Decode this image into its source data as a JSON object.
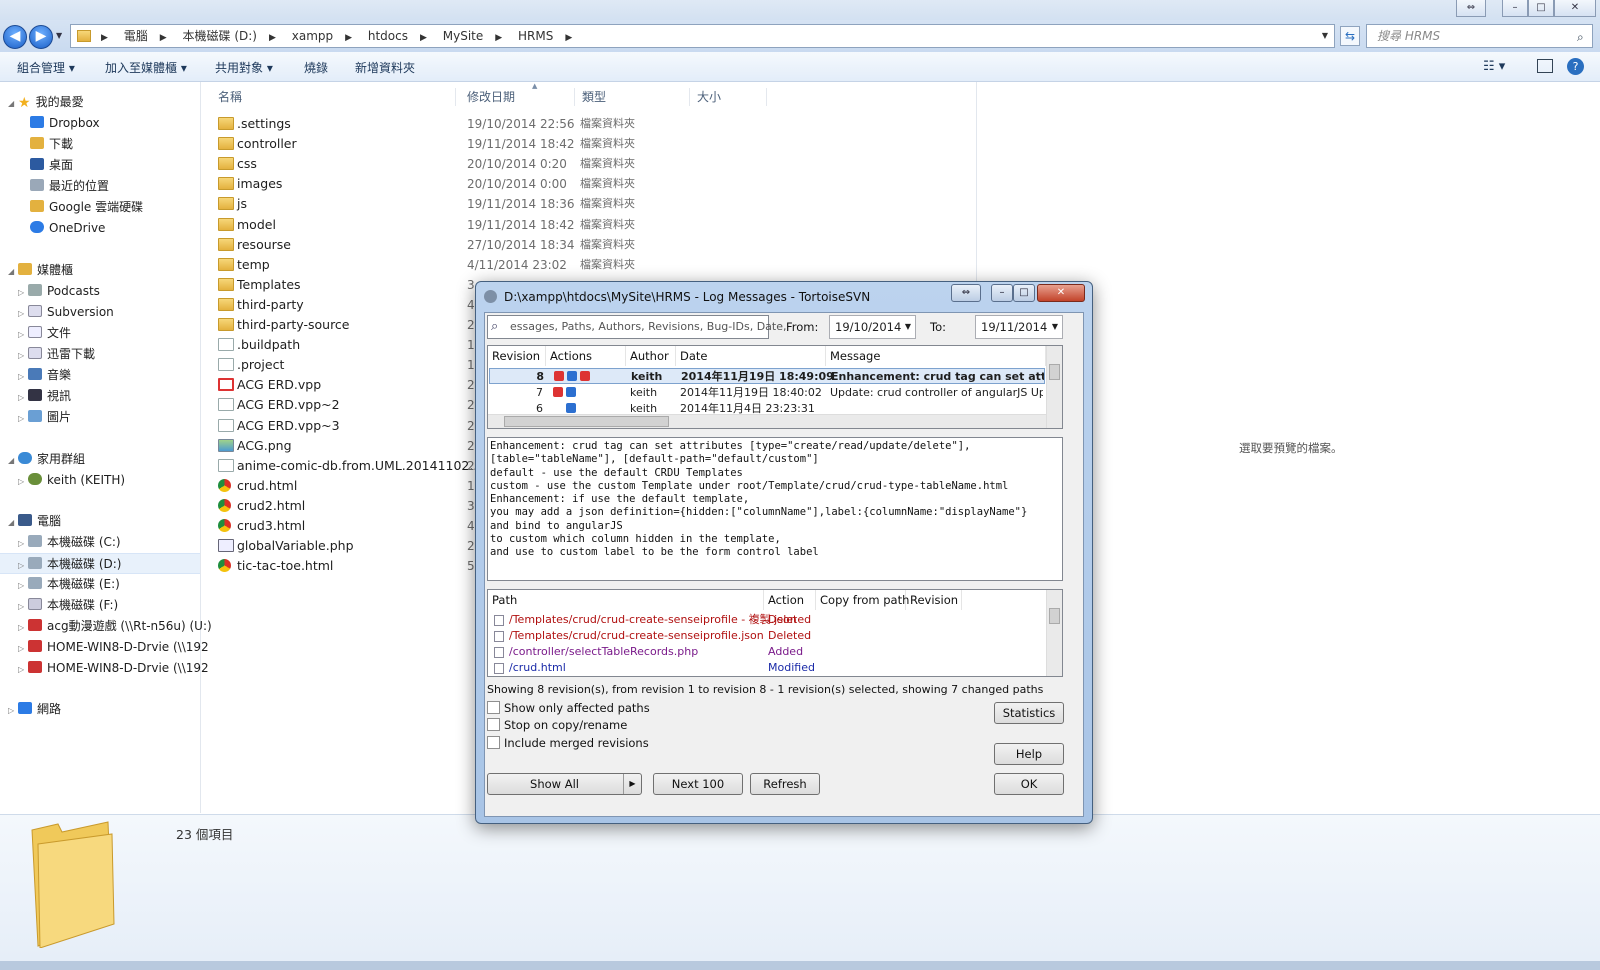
{
  "window": {
    "caption_buttons": [
      "⇔",
      "–",
      "□",
      "✕"
    ]
  },
  "address": {
    "crumbs": [
      "電腦",
      "本機磁碟 (D:)",
      "xampp",
      "htdocs",
      "MySite",
      "HRMS"
    ],
    "search_placeholder": "搜尋 HRMS"
  },
  "toolbar": {
    "organize": "組合管理 ▾",
    "add_library": "加入至媒體櫃 ▾",
    "share": "共用對象 ▾",
    "burn": "燒錄",
    "new_folder": "新增資料夾"
  },
  "sidebar": {
    "favorites": "我的最愛",
    "fav_items": [
      "Dropbox",
      "下載",
      "桌面",
      "最近的位置",
      "Google 雲端硬碟",
      "OneDrive"
    ],
    "libraries": "媒體櫃",
    "lib_items": [
      "Podcasts",
      "Subversion",
      "文件",
      "迅雷下載",
      "音樂",
      "視訊",
      "圖片"
    ],
    "homegroup": "家用群組",
    "home_items": [
      "keith (KEITH)"
    ],
    "computer": "電腦",
    "comp_items": [
      "本機磁碟 (C:)",
      "本機磁碟 (D:)",
      "本機磁碟 (E:)",
      "本機磁碟 (F:)",
      "acg動漫遊戲 (\\\\Rt-n56u) (U:)",
      "HOME-WIN8-D-Drvie (\\\\192",
      "HOME-WIN8-D-Drvie (\\\\192"
    ],
    "network": "網路"
  },
  "filelist": {
    "headers": {
      "name": "名稱",
      "modified": "修改日期",
      "type": "類型",
      "size": "大小"
    },
    "rows": [
      {
        "name": ".settings",
        "date": "19/10/2014 22:56",
        "type": "檔案資料夾",
        "kind": "folder"
      },
      {
        "name": "controller",
        "date": "19/11/2014 18:42",
        "type": "檔案資料夾",
        "kind": "folder"
      },
      {
        "name": "css",
        "date": "20/10/2014 0:20",
        "type": "檔案資料夾",
        "kind": "folder"
      },
      {
        "name": "images",
        "date": "20/10/2014 0:00",
        "type": "檔案資料夾",
        "kind": "folder"
      },
      {
        "name": "js",
        "date": "19/11/2014 18:36",
        "type": "檔案資料夾",
        "kind": "folder"
      },
      {
        "name": "model",
        "date": "19/11/2014 18:42",
        "type": "檔案資料夾",
        "kind": "folder"
      },
      {
        "name": "resourse",
        "date": "27/10/2014 18:34",
        "type": "檔案資料夾",
        "kind": "folder"
      },
      {
        "name": "temp",
        "date": "4/11/2014 23:02",
        "type": "檔案資料夾",
        "kind": "folder"
      },
      {
        "name": "Templates",
        "date": "3",
        "type": "",
        "kind": "folder"
      },
      {
        "name": "third-party",
        "date": "4",
        "type": "",
        "kind": "folder"
      },
      {
        "name": "third-party-source",
        "date": "2",
        "type": "",
        "kind": "folder"
      },
      {
        "name": ".buildpath",
        "date": "1",
        "type": "",
        "kind": "doc"
      },
      {
        "name": ".project",
        "date": "1",
        "type": "",
        "kind": "doc"
      },
      {
        "name": "ACG ERD.vpp",
        "date": "2",
        "type": "",
        "kind": "vpp"
      },
      {
        "name": "ACG ERD.vpp~2",
        "date": "2",
        "type": "",
        "kind": "doc"
      },
      {
        "name": "ACG ERD.vpp~3",
        "date": "2",
        "type": "",
        "kind": "doc"
      },
      {
        "name": "ACG.png",
        "date": "2",
        "type": "",
        "kind": "png"
      },
      {
        "name": "anime-comic-db.from.UML.20141102....",
        "date": "2",
        "type": "",
        "kind": "doc"
      },
      {
        "name": "crud.html",
        "date": "1",
        "type": "",
        "kind": "chr"
      },
      {
        "name": "crud2.html",
        "date": "3",
        "type": "",
        "kind": "chr"
      },
      {
        "name": "crud3.html",
        "date": "4",
        "type": "",
        "kind": "chr"
      },
      {
        "name": "globalVariable.php",
        "date": "2",
        "type": "",
        "kind": "php"
      },
      {
        "name": "tic-tac-toe.html",
        "date": "5",
        "type": "",
        "kind": "chr"
      }
    ]
  },
  "preview_text": "選取要預覽的檔案。",
  "status_count": "23 個項目",
  "dialog": {
    "title": "D:\\xampp\\htdocs\\MySite\\HRMS - Log Messages - TortoiseSVN",
    "filter_placeholder": "essages, Paths, Authors, Revisions, Bug-IDs, Date,",
    "from_label": "From:",
    "from_value": "19/10/2014",
    "to_label": "To:",
    "to_value": "19/11/2014",
    "log_headers": {
      "revision": "Revision",
      "actions": "Actions",
      "author": "Author",
      "date": "Date",
      "message": "Message"
    },
    "log_rows": [
      {
        "rev": "8",
        "author": "keith",
        "date": "2014年11月19日 18:49:09",
        "msg": "Enhancement: crud tag can set attribute"
      },
      {
        "rev": "7",
        "author": "keith",
        "date": "2014年11月19日 18:40:02",
        "msg": "Update: crud controller of angularJS Update: g"
      },
      {
        "rev": "6",
        "author": "keith",
        "date": "2014年11月4日 23:23:31",
        "msg": ""
      }
    ],
    "message_text": "Enhancement: crud tag can set attributes [type=\"create/read/update/delete\"],\n[table=\"tableName\"], [default-path=\"default/custom\"]\ndefault - use the default CRDU Templates\ncustom - use the custom Template under root/Template/crud/crud-type-tableName.html\nEnhancement: if use the default template,\nyou may add a json definition={hidden:[\"columnName\"],label:{columnName:\"displayName\"}\nand bind to angularJS\nto custom which column hidden in the template,\nand use to custom label to be the form control label",
    "path_headers": {
      "path": "Path",
      "action": "Action",
      "copy_from": "Copy from path",
      "revision": "Revision"
    },
    "path_rows": [
      {
        "path": "/Templates/crud/crud-create-senseiprofile - 複製.json",
        "action": "Deleted",
        "color": "#b01010"
      },
      {
        "path": "/Templates/crud/crud-create-senseiprofile.json",
        "action": "Deleted",
        "color": "#b01010"
      },
      {
        "path": "/controller/selectTableRecords.php",
        "action": "Added",
        "color": "#7a1a8a"
      },
      {
        "path": "/crud.html",
        "action": "Modified",
        "color": "#1a2aa8"
      }
    ],
    "summary": "Showing 8 revision(s), from revision 1 to revision 8 - 1 revision(s) selected, showing 7 changed paths",
    "checkboxes": [
      "Show only affected paths",
      "Stop on copy/rename",
      "Include merged revisions"
    ],
    "buttons": {
      "statistics": "Statistics",
      "help": "Help",
      "show_all": "Show All",
      "next100": "Next 100",
      "refresh": "Refresh",
      "ok": "OK"
    }
  }
}
